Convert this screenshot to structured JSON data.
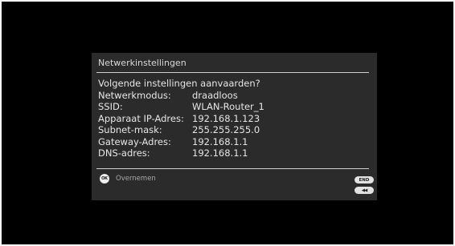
{
  "dialog": {
    "title": "Netwerkinstellingen",
    "question": "Volgende instellingen aanvaarden?",
    "rows": [
      {
        "label": "Netwerkmodus:",
        "value": "draadloos"
      },
      {
        "label": "SSID:",
        "value": "WLAN-Router_1"
      },
      {
        "label": "Apparaat IP-Adres:",
        "value": "192.168.1.123"
      },
      {
        "label": "Subnet-mask:",
        "value": "255.255.255.0"
      },
      {
        "label": "Gateway-Adres:",
        "value": "192.168.1.1"
      },
      {
        "label": "DNS-adres:",
        "value": "192.168.1.1"
      }
    ]
  },
  "footer": {
    "ok_icon_text": "OK",
    "ok_label": "Overnemen",
    "end_button": "END",
    "back_button": "◀◀"
  },
  "colors": {
    "screen_background": "#000000",
    "dialog_background": "#2b2b2b",
    "text": "#e6e6e6",
    "muted_text": "#a8a8a8"
  }
}
